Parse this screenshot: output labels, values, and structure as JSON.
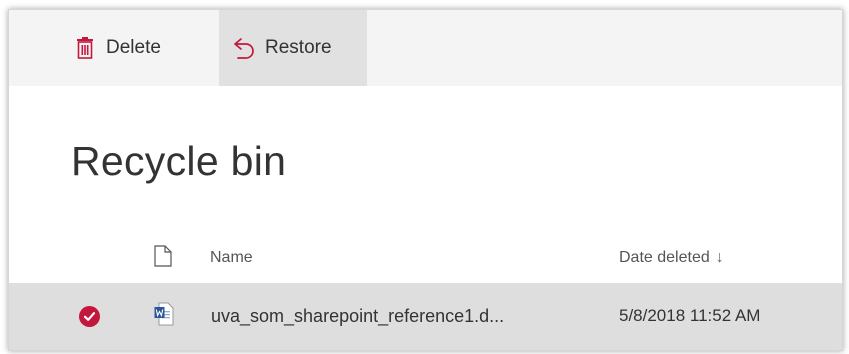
{
  "command_bar": {
    "delete_label": "Delete",
    "restore_label": "Restore"
  },
  "page": {
    "title": "Recycle bin"
  },
  "columns": {
    "name": "Name",
    "date_deleted": "Date deleted",
    "sort_indicator": "↓"
  },
  "rows": [
    {
      "name": "uva_som_sharepoint_reference1.d...",
      "date_deleted": "5/8/2018 11:52 AM",
      "selected": true,
      "file_icon": "word-document-icon"
    }
  ],
  "colors": {
    "accent": "#c3173b",
    "command_bar_bg": "#f4f4f4",
    "selected_row_bg": "#dedede",
    "word_blue": "#2b579a"
  },
  "icons": {
    "delete": "trash-icon",
    "restore": "undo-icon",
    "file_type_header": "document-icon",
    "row_check": "checkmark-icon"
  }
}
